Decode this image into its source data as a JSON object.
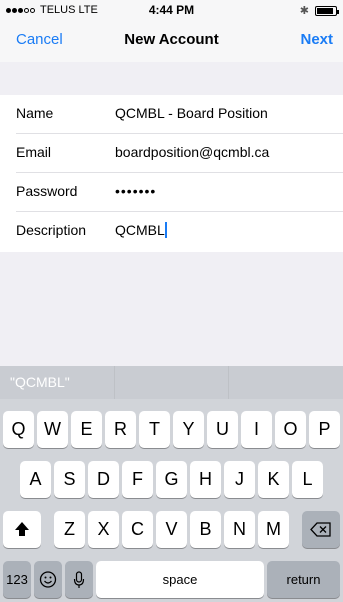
{
  "status": {
    "carrier": "TELUS",
    "network": "LTE",
    "time": "4:44 PM",
    "bluetooth_icon": "bluetooth-icon",
    "battery_level": 0.9
  },
  "nav": {
    "cancel": "Cancel",
    "title": "New Account",
    "next": "Next"
  },
  "form": {
    "fields": [
      {
        "label": "Name",
        "value": "QCMBL - Board Position"
      },
      {
        "label": "Email",
        "value": "boardposition@qcmbl.ca"
      },
      {
        "label": "Password",
        "value": "•••••••"
      },
      {
        "label": "Description",
        "value": "QCMBL"
      }
    ]
  },
  "keyboard": {
    "suggestions": [
      "\"QCMBL\"",
      "",
      ""
    ],
    "row1": [
      "Q",
      "W",
      "E",
      "R",
      "T",
      "Y",
      "U",
      "I",
      "O",
      "P"
    ],
    "row2": [
      "A",
      "S",
      "D",
      "F",
      "G",
      "H",
      "J",
      "K",
      "L"
    ],
    "row3": [
      "Z",
      "X",
      "C",
      "V",
      "B",
      "N",
      "M"
    ],
    "numbers": "123",
    "space": "space",
    "return": "return"
  },
  "colors": {
    "accent": "#1a7cf5",
    "keyboard_bg": "#d1d4d9",
    "page_bg": "#f0eff4"
  }
}
